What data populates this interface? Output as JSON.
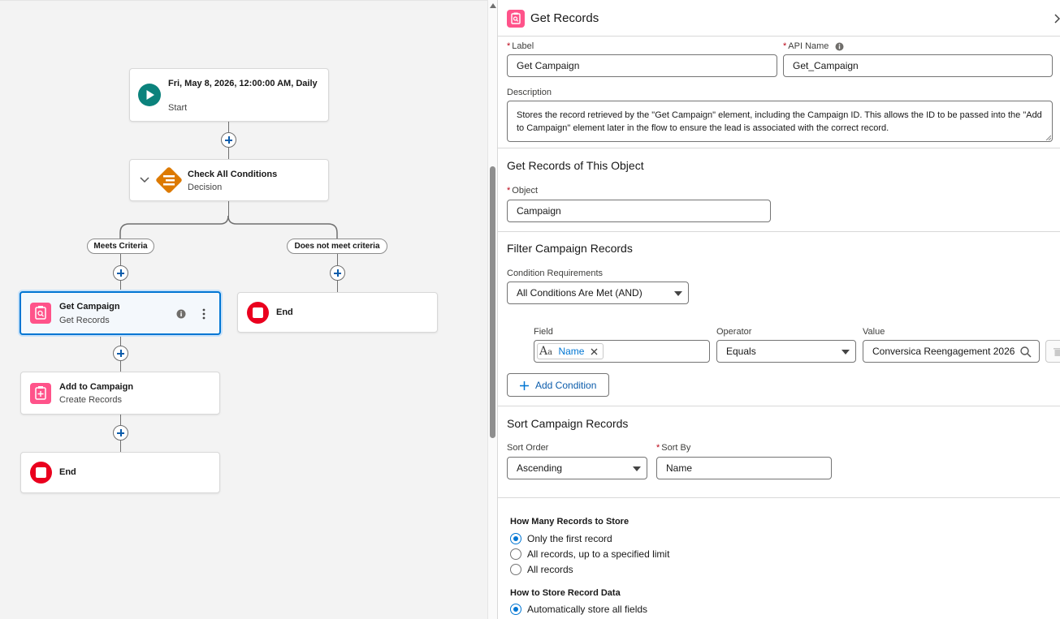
{
  "flow": {
    "start": {
      "title": "Fri, May 8, 2026, 12:00:00 AM, Daily",
      "subtitle": "Start"
    },
    "decision": {
      "title": "Check All Conditions",
      "subtitle": "Decision"
    },
    "branch_left_label": "Meets Criteria",
    "branch_right_label": "Does not meet criteria",
    "get_campaign": {
      "title": "Get Campaign",
      "subtitle": "Get Records"
    },
    "end_right": {
      "title": "End"
    },
    "add_to_campaign": {
      "title": "Add to Campaign",
      "subtitle": "Create Records"
    },
    "end_bottom": {
      "title": "End"
    }
  },
  "panel": {
    "header_title": "Get Records",
    "label_field": {
      "label": "Label",
      "value": "Get Campaign"
    },
    "api_name_field": {
      "label": "API Name",
      "value": "Get_Campaign"
    },
    "description": {
      "label": "Description",
      "value": "Stores the record retrieved by the \"Get Campaign\" element, including the Campaign ID. This allows the ID to be passed into the \"Add to Campaign\" element later in the flow to ensure the lead is associated with the correct record."
    },
    "object_section": {
      "title": "Get Records of This Object",
      "object_label": "Object",
      "object_value": "Campaign"
    },
    "filter_section": {
      "title": "Filter Campaign Records",
      "condition_req_label": "Condition Requirements",
      "condition_req_value": "All Conditions Are Met (AND)",
      "field_col": "Field",
      "operator_col": "Operator",
      "value_col": "Value",
      "field_value": "Name",
      "operator_value": "Equals",
      "value_value": "Conversica Reengagement 2026",
      "add_condition": "Add Condition"
    },
    "sort_section": {
      "title": "Sort Campaign Records",
      "sort_order_label": "Sort Order",
      "sort_order_value": "Ascending",
      "sort_by_label": "Sort By",
      "sort_by_value": "Name"
    },
    "store": {
      "how_many_title": "How Many Records to Store",
      "options": [
        "Only the first record",
        "All records, up to a specified limit",
        "All records"
      ],
      "selected": 0,
      "how_to_store_title": "How to Store Record Data",
      "store_option": "Automatically store all fields"
    }
  },
  "colors": {
    "accent": "#0176d3",
    "pink_icon": "#ff538a",
    "decision": "#dd7a01",
    "start": "#0b827c",
    "end": "#ea001e"
  }
}
